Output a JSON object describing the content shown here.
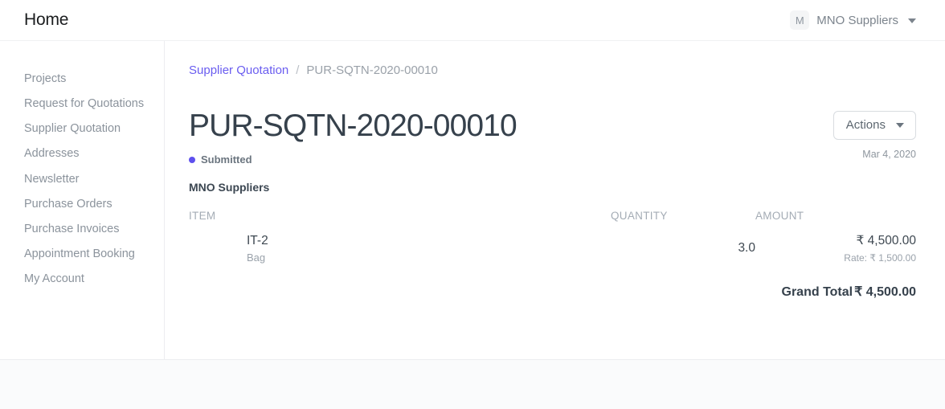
{
  "navbar": {
    "brand": "Home",
    "avatar_initial": "M",
    "user_name": "MNO Suppliers",
    "caret_icon": "chevron-down-icon"
  },
  "sidebar": {
    "items": [
      {
        "label": "Projects"
      },
      {
        "label": "Request for Quotations"
      },
      {
        "label": "Supplier Quotation"
      },
      {
        "label": "Addresses"
      },
      {
        "label": "Newsletter"
      },
      {
        "label": "Purchase Orders"
      },
      {
        "label": "Purchase Invoices"
      },
      {
        "label": "Appointment Booking"
      },
      {
        "label": "My Account"
      }
    ]
  },
  "breadcrumb": {
    "parent": "Supplier Quotation",
    "separator": "/",
    "current": "PUR-SQTN-2020-00010"
  },
  "document": {
    "title": "PUR-SQTN-2020-00010",
    "status": "Submitted",
    "status_color": "#5e50ee",
    "date": "Mar 4, 2020",
    "supplier": "MNO Suppliers"
  },
  "toolbar": {
    "actions_label": "Actions",
    "actions_caret_icon": "caret-down-icon"
  },
  "table": {
    "headers": {
      "item": "ITEM",
      "quantity": "QUANTITY",
      "amount": "AMOUNT"
    },
    "rows": [
      {
        "item_code": "IT-2",
        "uom": "Bag",
        "quantity": "3.0",
        "amount": "₹ 4,500.00",
        "rate": "Rate: ₹ 1,500.00"
      }
    ]
  },
  "totals": {
    "grand_total_label": "Grand Total",
    "grand_total_value": "₹ 4,500.00"
  },
  "theme": {
    "accent": "#5e50ee",
    "link": "#6a5df0",
    "page_bg": "#fafbfc",
    "card_bg": "#ffffff"
  }
}
